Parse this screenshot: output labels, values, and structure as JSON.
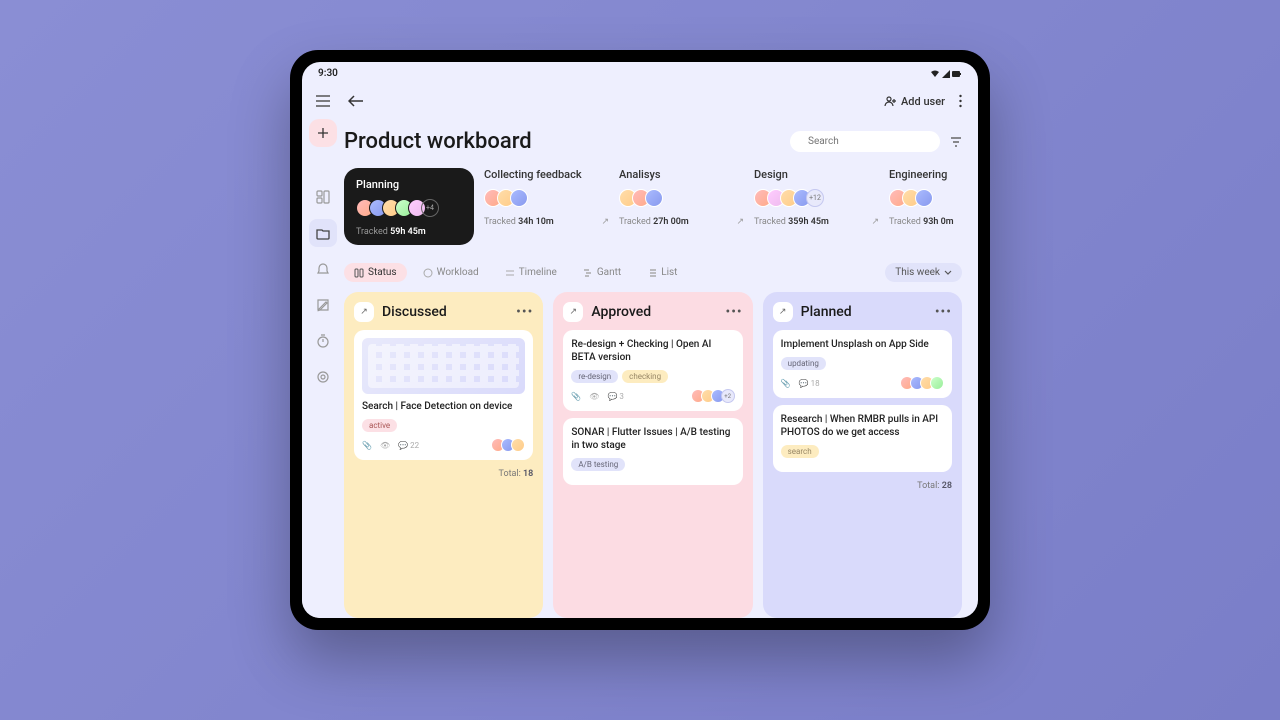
{
  "status_bar": {
    "time": "9:30"
  },
  "header": {
    "add_user_label": "Add user",
    "page_title": "Product workboard",
    "search_placeholder": "Search"
  },
  "stages": [
    {
      "title": "Planning",
      "tracked_label": "Tracked",
      "tracked_value": "59h 45m",
      "extra": "+4",
      "dark": true
    },
    {
      "title": "Collecting feedback",
      "tracked_label": "Tracked",
      "tracked_value": "34h 10m"
    },
    {
      "title": "Analisys",
      "tracked_label": "Tracked",
      "tracked_value": "27h 00m"
    },
    {
      "title": "Design",
      "tracked_label": "Tracked",
      "tracked_value": "359h 45m",
      "extra": "+12"
    },
    {
      "title": "Engineering",
      "tracked_label": "Tracked",
      "tracked_value": "93h 0m"
    }
  ],
  "tabs": [
    {
      "label": "Status",
      "active": true
    },
    {
      "label": "Workload"
    },
    {
      "label": "Timeline"
    },
    {
      "label": "Gantt"
    },
    {
      "label": "List"
    }
  ],
  "week_filter": "This week",
  "boards": [
    {
      "title": "Discussed",
      "color": "yellow",
      "total_label": "Total:",
      "total": "18",
      "cards": [
        {
          "title": "Search | Face Detection on device",
          "has_image": true,
          "tags": [
            {
              "text": "active",
              "color": "pink"
            }
          ],
          "comments": "22"
        }
      ]
    },
    {
      "title": "Approved",
      "color": "pink",
      "cards": [
        {
          "title": "Re-design + Checking | Open AI BETA version",
          "tags": [
            {
              "text": "re-design",
              "color": "purple"
            },
            {
              "text": "checking",
              "color": "yellow"
            }
          ],
          "comments": "3",
          "extra": "+2"
        },
        {
          "title": "SONAR | Flutter Issues | A/B testing in two stage",
          "tags": [
            {
              "text": "A/B testing",
              "color": "purple"
            }
          ]
        }
      ]
    },
    {
      "title": "Planned",
      "color": "purple",
      "total_label": "Total:",
      "total": "28",
      "cards": [
        {
          "title": "Implement Unsplash on App Side",
          "tags": [
            {
              "text": "updating",
              "color": "purple"
            }
          ],
          "comments": "18"
        },
        {
          "title": "Research | When RMBR pulls in API PHOTOS do we get access",
          "tags": [
            {
              "text": "search",
              "color": "yellow"
            }
          ]
        }
      ]
    }
  ]
}
